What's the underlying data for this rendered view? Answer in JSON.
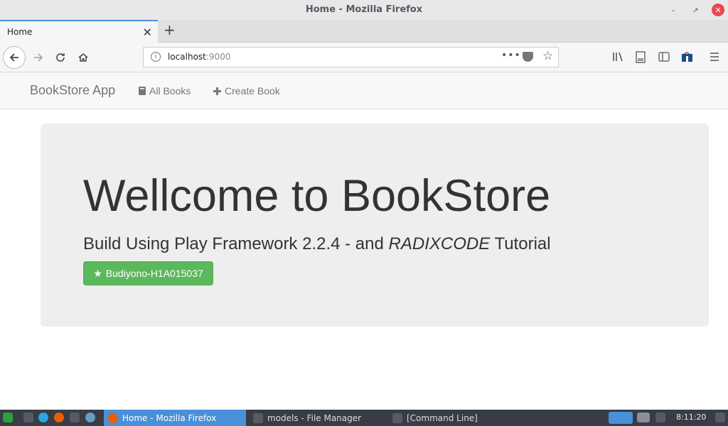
{
  "window": {
    "title": "Home - Mozilla Firefox"
  },
  "tabs": [
    {
      "label": "Home"
    }
  ],
  "url": {
    "host": "localhost",
    "port": ":9000"
  },
  "app": {
    "brand": "BookStore App",
    "nav": [
      {
        "label": "All Books",
        "icon": "book-icon"
      },
      {
        "label": "Create Book",
        "icon": "plus-icon"
      }
    ]
  },
  "hero": {
    "heading": "Wellcome to BookStore",
    "lead_prefix": "Build Using Play Framework 2.2.4 - and ",
    "lead_em": "RADIXCODE",
    "lead_suffix": " Tutorial",
    "button_label": "Budiyono-H1A015037",
    "button_icon": "star-icon"
  },
  "taskbar": {
    "tasks": [
      {
        "label": "Home - Mozilla Firefox",
        "active": true
      },
      {
        "label": "models - File Manager",
        "active": false
      },
      {
        "label": "[Command Line]",
        "active": false
      }
    ],
    "clock": "8:11:20"
  },
  "colors": {
    "button": "#5cb85c",
    "jumbotron": "#eeeeee",
    "accent": "#4a90d9"
  }
}
